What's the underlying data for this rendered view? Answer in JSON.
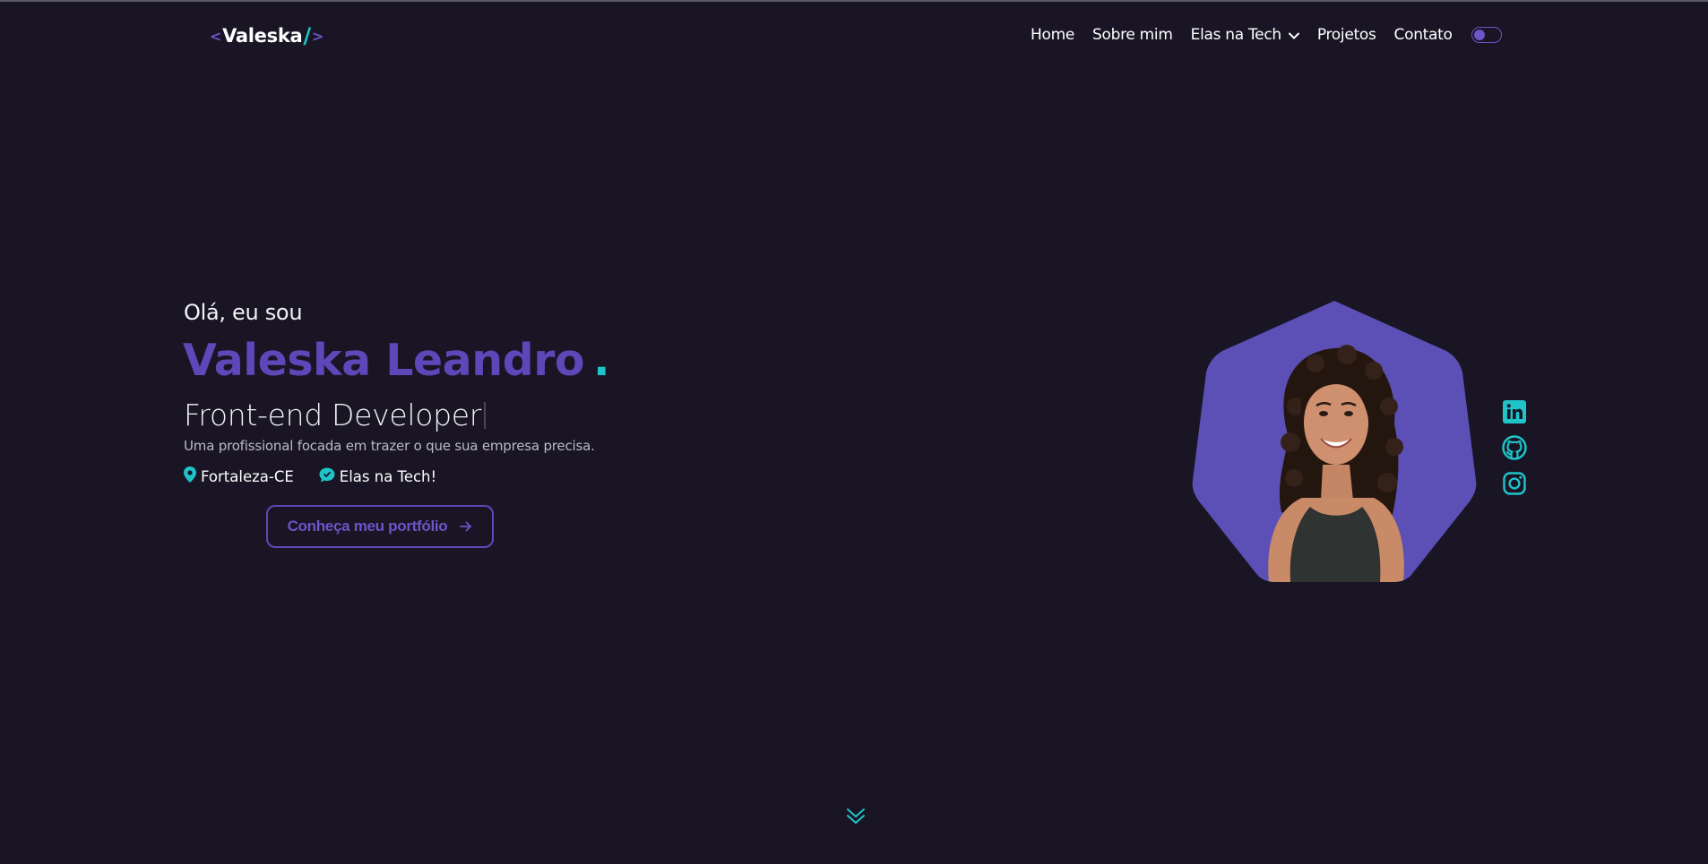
{
  "logo": {
    "left_bracket": "<",
    "name": "Valeska",
    "slash": "/",
    "right_bracket": ">"
  },
  "nav": {
    "items": [
      {
        "label": "Home"
      },
      {
        "label": "Sobre mim"
      },
      {
        "label": "Elas na Tech",
        "has_dropdown": true
      },
      {
        "label": "Projetos"
      },
      {
        "label": "Contato"
      }
    ],
    "theme_toggle": {
      "state": "off"
    }
  },
  "hero": {
    "greeting": "Olá, eu sou",
    "name": "Valeska Leandro",
    "name_dot": ".",
    "role": "Front-end Developer",
    "tagline": "Uma profissional focada em trazer o que sua empresa precisa.",
    "location": "Fortaleza-CE",
    "community": "Elas na Tech!",
    "cta_label": "Conheça meu portfólio"
  },
  "social": [
    "linkedin-icon",
    "github-icon",
    "instagram-icon"
  ],
  "colors": {
    "background": "#191524",
    "primary": "#5c48b8",
    "accent": "#1fc4c9",
    "text": "#ffffff"
  }
}
